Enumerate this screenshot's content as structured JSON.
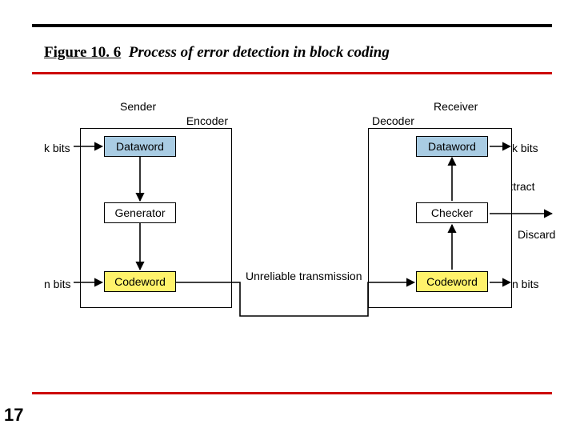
{
  "title": {
    "fig": "Figure 10. 6",
    "caption": "Process of error detection in block coding"
  },
  "page_number": "17",
  "labels": {
    "sender": "Sender",
    "receiver": "Receiver",
    "encoder": "Encoder",
    "decoder": "Decoder",
    "kbits": "k bits",
    "nbits": "n bits",
    "transmission": "Unreliable transmission",
    "extract": "Extract",
    "discard": "Discard"
  },
  "boxes": {
    "dataword": "Dataword",
    "generator": "Generator",
    "codeword": "Codeword",
    "checker": "Checker"
  }
}
